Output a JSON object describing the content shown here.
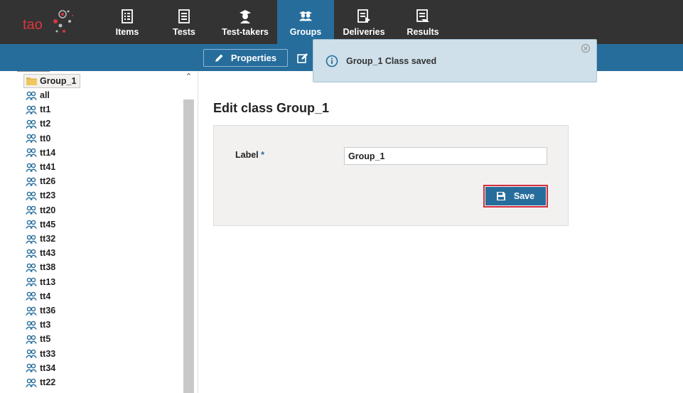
{
  "nav": {
    "items": [
      {
        "label": "Items",
        "icon": "items-icon"
      },
      {
        "label": "Tests",
        "icon": "tests-icon"
      },
      {
        "label": "Test-takers",
        "icon": "test-takers-icon"
      },
      {
        "label": "Groups",
        "icon": "groups-icon"
      },
      {
        "label": "Deliveries",
        "icon": "deliveries-icon"
      },
      {
        "label": "Results",
        "icon": "results-icon"
      }
    ],
    "active": "Groups",
    "logo_text": "tao"
  },
  "actionbar": {
    "properties_label": "Properties"
  },
  "notification": {
    "message": "Group_1 Class saved"
  },
  "tree": {
    "selected": "Group_1",
    "items": [
      "Group_1",
      "all",
      "tt1",
      "tt2",
      "tt0",
      "tt14",
      "tt41",
      "tt26",
      "tt23",
      "tt20",
      "tt45",
      "tt32",
      "tt43",
      "tt38",
      "tt13",
      "tt4",
      "tt36",
      "tt3",
      "tt5",
      "tt33",
      "tt34",
      "tt22"
    ]
  },
  "main": {
    "title": "Edit class Group_1",
    "label_text": "Label",
    "required_mark": "*",
    "label_value": "Group_1",
    "save_label": "Save"
  },
  "colors": {
    "topbar": "#333333",
    "accent": "#266d9c",
    "highlight": "#d62b3e",
    "notice_bg": "#cfe0ea"
  }
}
